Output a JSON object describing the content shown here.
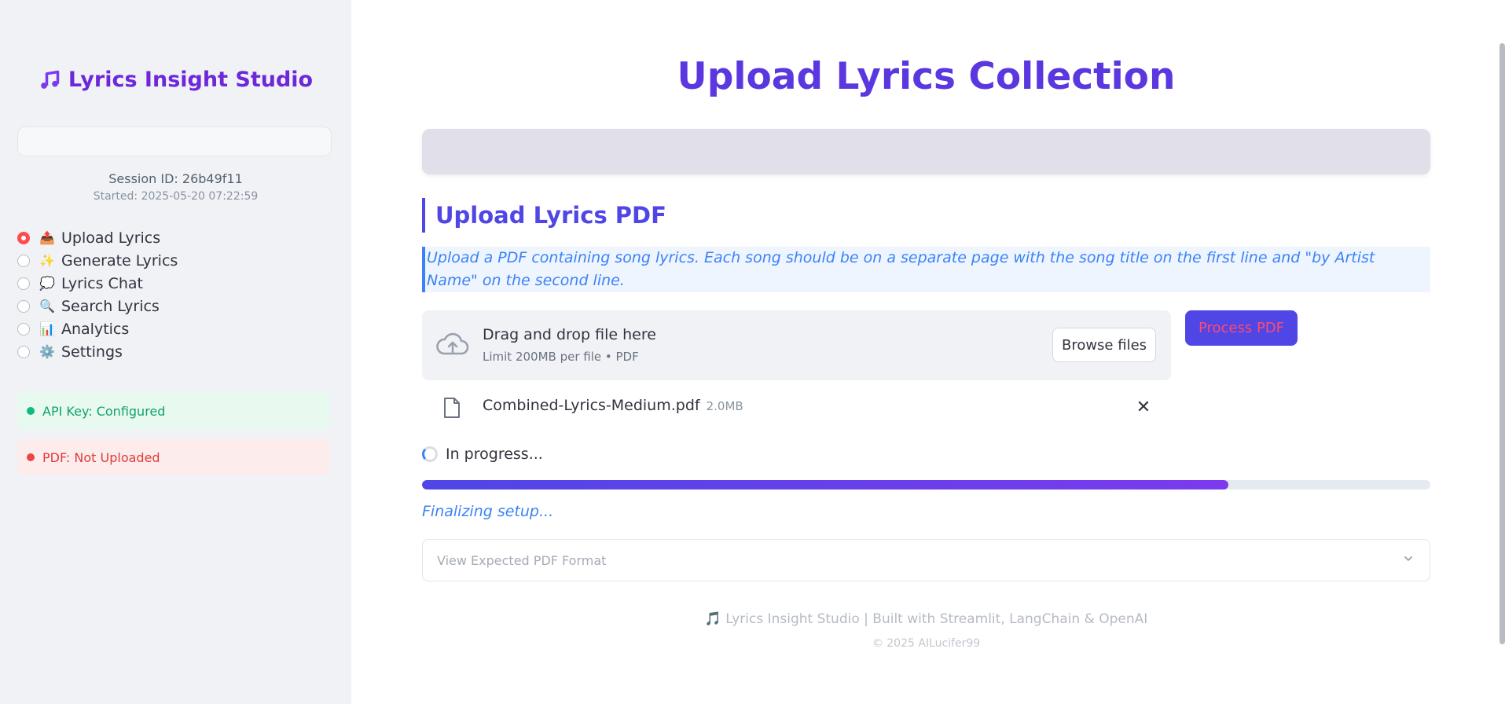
{
  "sidebar": {
    "brand": "Lyrics Insight Studio",
    "session_id": "Session ID: 26b49f11",
    "started": "Started: 2025-05-20 07:22:59",
    "nav": [
      {
        "emoji": "📤",
        "label": "Upload Lyrics",
        "selected": true
      },
      {
        "emoji": "✨",
        "label": "Generate Lyrics",
        "selected": false
      },
      {
        "emoji": "💭",
        "label": "Lyrics Chat",
        "selected": false
      },
      {
        "emoji": "🔍",
        "label": "Search Lyrics",
        "selected": false
      },
      {
        "emoji": "📊",
        "label": "Analytics",
        "selected": false
      },
      {
        "emoji": "⚙️",
        "label": "Settings",
        "selected": false
      }
    ],
    "api_status": "API Key: Configured",
    "pdf_status": "PDF: Not Uploaded"
  },
  "main": {
    "title": "Upload Lyrics Collection",
    "section_title": "Upload Lyrics PDF",
    "info": "Upload a PDF containing song lyrics. Each song should be on a separate page with the song title on the first line and \"by Artist Name\" on the second line.",
    "uploader": {
      "drag_text": "Drag and drop file here",
      "limit_text": "Limit 200MB per file • PDF",
      "browse_label": "Browse files"
    },
    "process_label": "Process PDF",
    "file": {
      "name": "Combined-Lyrics-Medium.pdf",
      "size": "2.0MB"
    },
    "progress_label": "In progress...",
    "progress_fraction": 0.8,
    "finalizing": "Finalizing setup...",
    "expander_label": "View Expected PDF Format",
    "footer_line1": "🎵 Lyrics Insight Studio | Built with Streamlit, LangChain & OpenAI",
    "footer_line2": "© 2025 AILucifer99"
  },
  "colors": {
    "accent": "#4f46e5",
    "brand": "#6d28d9",
    "success": "#10b981",
    "danger": "#ef4444",
    "info": "#3b82f6"
  },
  "icons": {
    "brand": "music-note-icon",
    "uploader": "cloud-upload-icon",
    "file": "file-icon",
    "remove": "close-icon",
    "expander": "chevron-down-icon"
  }
}
